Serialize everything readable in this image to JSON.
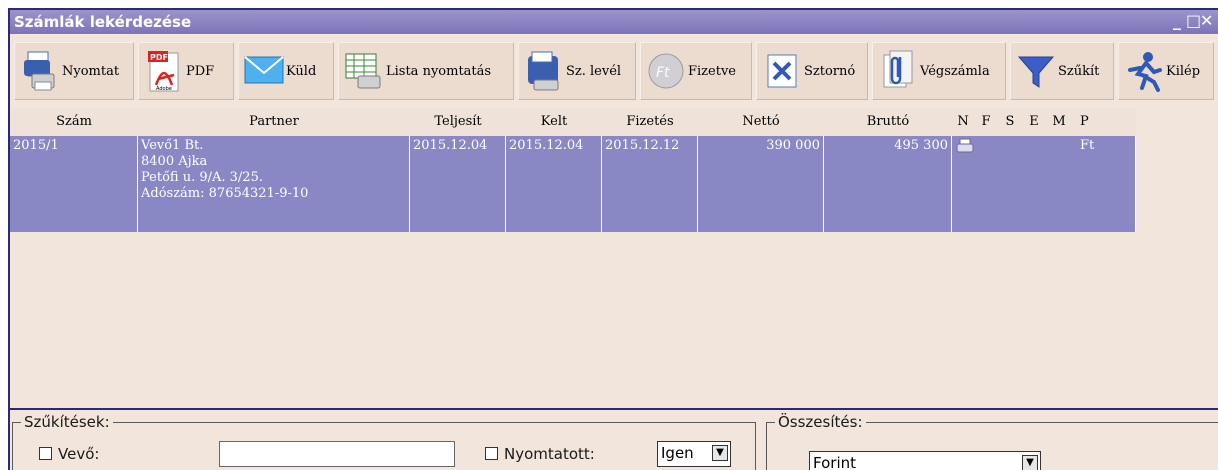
{
  "window": {
    "title": "Számlák lekérdezése",
    "controls": [
      "_",
      "□",
      "✕"
    ]
  },
  "toolbar": [
    {
      "id": "nyomtat",
      "label": "Nyomtat",
      "icon": "printer-document-icon"
    },
    {
      "id": "pdf",
      "label": "PDF",
      "icon": "pdf-icon",
      "icon_text": "PDF",
      "icon_sub": "Adobe"
    },
    {
      "id": "kuld",
      "label": "Küld",
      "icon": "envelope-icon"
    },
    {
      "id": "lista",
      "label": "Lista nyomtatás",
      "icon": "list-print-icon"
    },
    {
      "id": "szlevel",
      "label": "Sz. levél",
      "icon": "letter-print-icon"
    },
    {
      "id": "fizetve",
      "label": "Fizetve",
      "icon": "ft-coin-icon",
      "icon_text": "Ft"
    },
    {
      "id": "sztorno",
      "label": "Sztornó",
      "icon": "cancel-x-icon"
    },
    {
      "id": "vegszamla",
      "label": "Végszámla",
      "icon": "paperclip-icon"
    },
    {
      "id": "szukit",
      "label": "Szűkít",
      "icon": "funnel-icon"
    },
    {
      "id": "kilep",
      "label": "Kilép",
      "icon": "running-man-icon"
    }
  ],
  "table": {
    "columns": [
      "Szám",
      "Partner",
      "Teljesít",
      "Kelt",
      "Fizetés",
      "Nettó",
      "Bruttó",
      "N",
      "F",
      "S",
      "E",
      "M",
      "P"
    ],
    "rows": [
      {
        "szam": "2015/1",
        "partner": [
          "Vevő1 Bt.",
          "8400 Ajka",
          "Petőfi u. 9/A. 3/25.",
          "Adószám: 87654321-9-10"
        ],
        "teljesit": "2015.12.04",
        "kelt": "2015.12.04",
        "fizetes": "2015.12.12",
        "netto": "390 000",
        "brutto": "495 300",
        "n_icon": "printer-icon",
        "p": "Ft"
      }
    ]
  },
  "filters": {
    "legend": "Szűkítések:",
    "vevo_label": "Vevő:",
    "vevo_value": "",
    "nyomtatott_label": "Nyomtatott:",
    "nyomtatott_value": "Igen"
  },
  "summary": {
    "legend": "Összesítés:",
    "currency_value": "Forint"
  }
}
